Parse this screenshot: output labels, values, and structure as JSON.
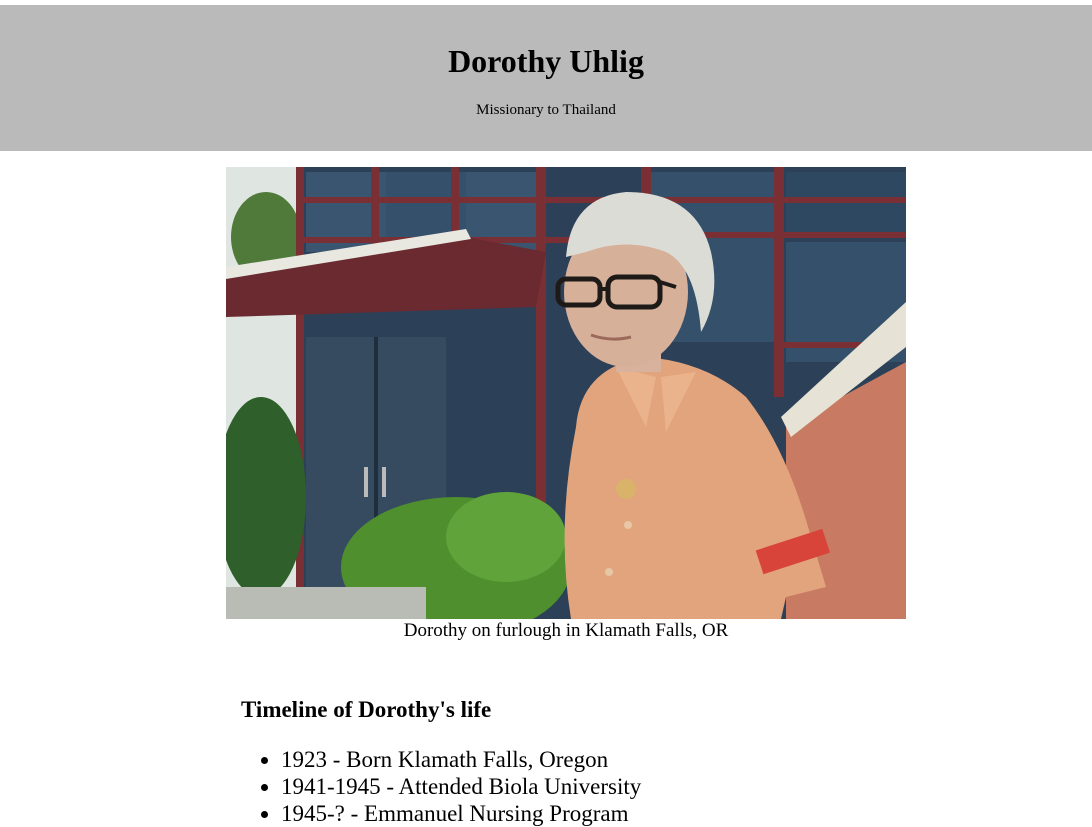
{
  "header": {
    "title": "Dorothy Uhlig",
    "subtitle": "Missionary to Thailand"
  },
  "photo": {
    "caption": "Dorothy on furlough in Klamath Falls, OR"
  },
  "timeline": {
    "title": "Timeline of Dorothy's life",
    "items": [
      "1923 - Born Klamath Falls, Oregon",
      "1941-1945 - Attended Biola University",
      "1945-? - Emmanuel Nursing Program"
    ]
  }
}
